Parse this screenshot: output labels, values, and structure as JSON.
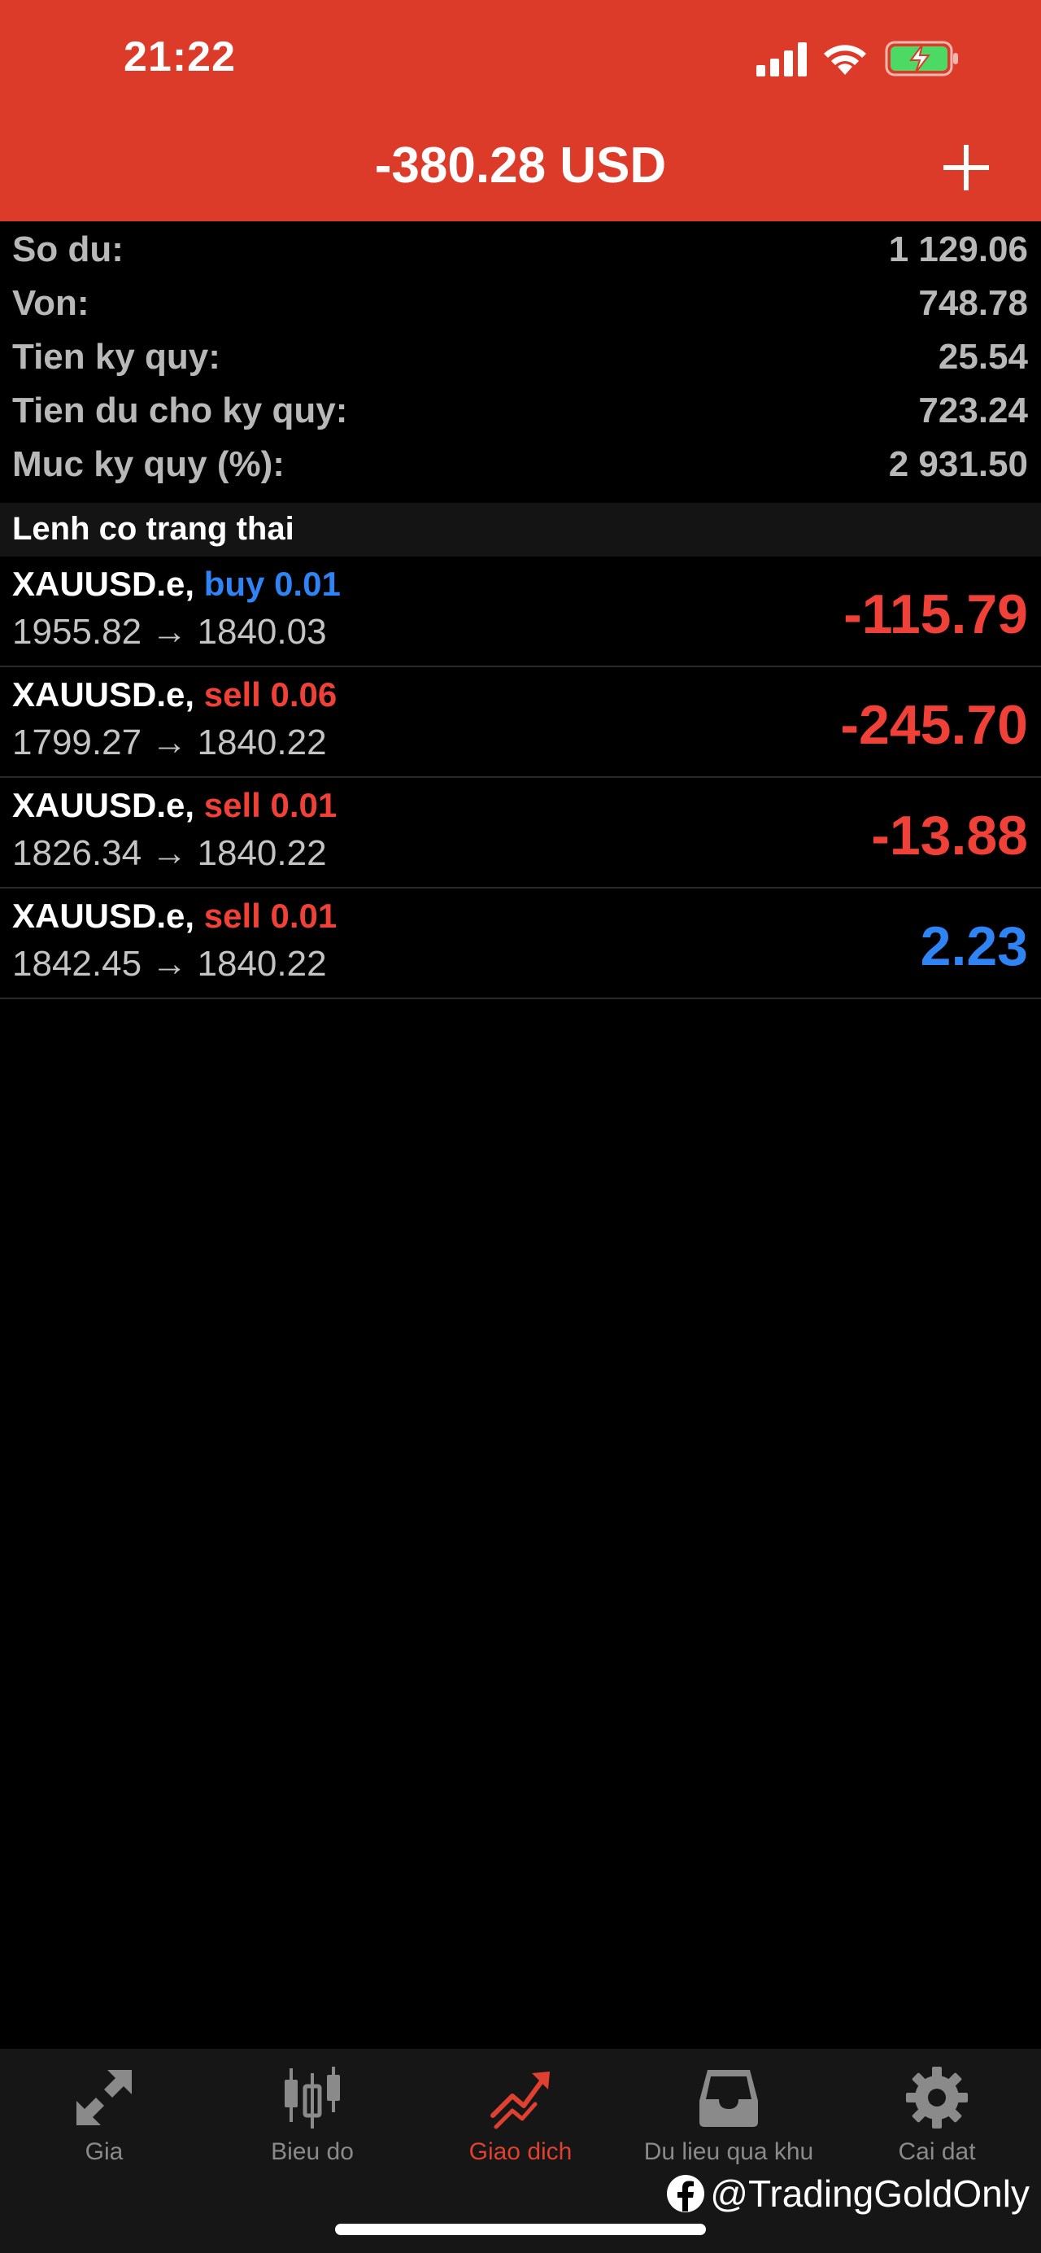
{
  "status_bar": {
    "time": "21:22"
  },
  "header": {
    "title": "-380.28 USD"
  },
  "summary": [
    {
      "label": "So du:",
      "value": "1 129.06"
    },
    {
      "label": "Von:",
      "value": "748.78"
    },
    {
      "label": "Tien ky quy:",
      "value": "25.54"
    },
    {
      "label": "Tien du cho ky quy:",
      "value": "723.24"
    },
    {
      "label": "Muc ky quy (%):",
      "value": "2 931.50"
    }
  ],
  "section": {
    "title": "Lenh co trang thai"
  },
  "positions": [
    {
      "symbol": "XAUUSD.e,",
      "side": "buy 0.01",
      "prices": "1955.82 → 1840.03",
      "profit": "-115.79"
    },
    {
      "symbol": "XAUUSD.e,",
      "side": "sell 0.06",
      "prices": "1799.27 → 1840.22",
      "profit": "-245.70"
    },
    {
      "symbol": "XAUUSD.e,",
      "side": "sell 0.01",
      "prices": "1826.34 → 1840.22",
      "profit": "-13.88"
    },
    {
      "symbol": "XAUUSD.e,",
      "side": "sell 0.01",
      "prices": "1842.45 → 1840.22",
      "profit": "2.23"
    }
  ],
  "tabs": [
    {
      "label": "Gia",
      "icon": "quotes-arrows-icon"
    },
    {
      "label": "Bieu do",
      "icon": "candlestick-chart-icon"
    },
    {
      "label": "Giao dich",
      "icon": "trade-chart-icon",
      "active": true
    },
    {
      "label": "Du lieu qua khu",
      "icon": "inbox-history-icon"
    },
    {
      "label": "Cai dat",
      "icon": "gear-icon"
    }
  ],
  "watermark": {
    "text": "@TradingGoldOnly",
    "icon": "facebook-icon"
  },
  "colors": {
    "header_bg": "#dd3b2a",
    "buy": "#2e83f5",
    "sell": "#ef4138",
    "loss": "#ef4138",
    "profit": "#2e83f5",
    "active_tab": "#e0402f"
  }
}
